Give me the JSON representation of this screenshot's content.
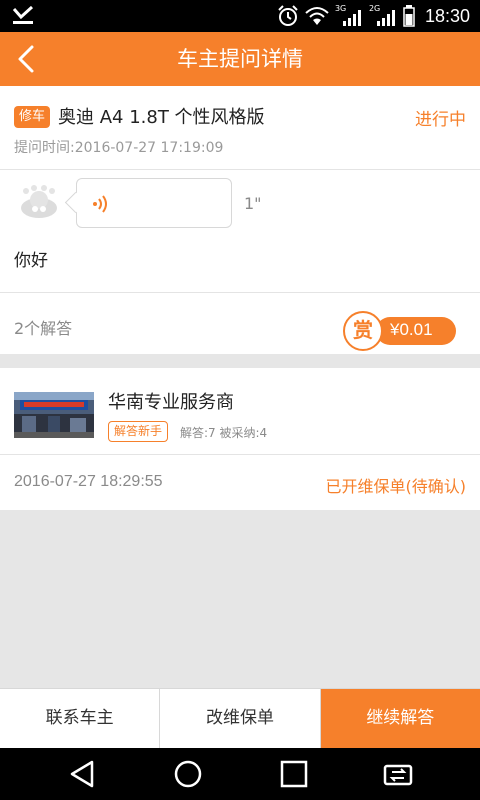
{
  "status_bar": {
    "time": "18:30",
    "sim1_tag": "3G",
    "sim2_tag": "2G",
    "icons": [
      "download-done-icon",
      "alarm-icon",
      "wifi-icon",
      "signal-icon",
      "signal-icon",
      "battery-icon"
    ]
  },
  "header": {
    "title": "车主提问详情",
    "back_icon": "back-arrow-icon"
  },
  "question": {
    "tag": "修车",
    "car": "奥迪 A4 1.8T 个性风格版",
    "status": "进行中",
    "time": "提问时间:2016-07-27 17:19:09",
    "voice_duration": "1\"",
    "text": "你好",
    "answer_count": "2个解答",
    "reward_badge": "赏",
    "reward_amount": "¥0.01"
  },
  "answer": {
    "shop_name": "华南专业服务商",
    "badge": "解答新手",
    "stats": "解答:7 被采纳:4",
    "time": "2016-07-27 18:29:55",
    "status": "已开维保单(待确认)"
  },
  "actions": {
    "contact": "联系车主",
    "modify": "改维保单",
    "continue": "继续解答"
  },
  "colors": {
    "accent": "#f6802b",
    "background": "#e6e6e6"
  }
}
